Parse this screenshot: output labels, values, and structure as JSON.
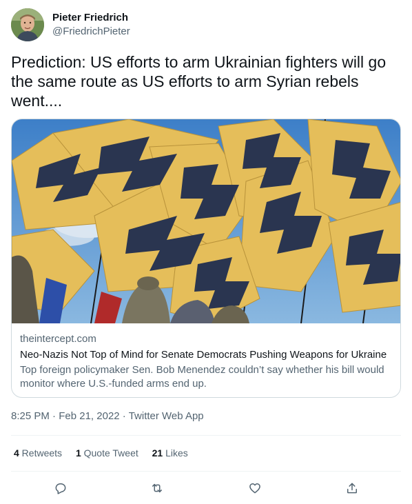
{
  "author": {
    "display_name": "Pieter Friedrich",
    "handle": "@FriedrichPieter"
  },
  "tweet": {
    "text": "Prediction: US efforts to arm Ukrainian fighters will go the same route as US efforts to arm Syrian rebels went...."
  },
  "card": {
    "domain": "theintercept.com",
    "title": "Neo-Nazis Not Top of Mind for Senate Democrats Pushing Weapons for Ukraine",
    "description": "Top foreign policymaker Sen. Bob Menendez couldn’t say whether his bill would monitor where U.S.-funded arms end up."
  },
  "meta": {
    "time": "8:25 PM",
    "separator": " · ",
    "date": "Feb 21, 2022",
    "source": "Twitter Web App"
  },
  "stats": {
    "retweets_count": "4",
    "retweets_label": " Retweets",
    "quotes_count": "1",
    "quotes_label": " Quote Tweet",
    "likes_count": "21",
    "likes_label": " Likes"
  },
  "actions": [
    "reply-icon",
    "retweet-icon",
    "like-icon",
    "share-icon"
  ],
  "colors": {
    "text": "#0f1419",
    "secondary": "#536471",
    "border": "#cfd9de",
    "flag_yellow": "#e8c15a",
    "flag_blue": "#2a3550",
    "sky": "#4a8fd4"
  }
}
